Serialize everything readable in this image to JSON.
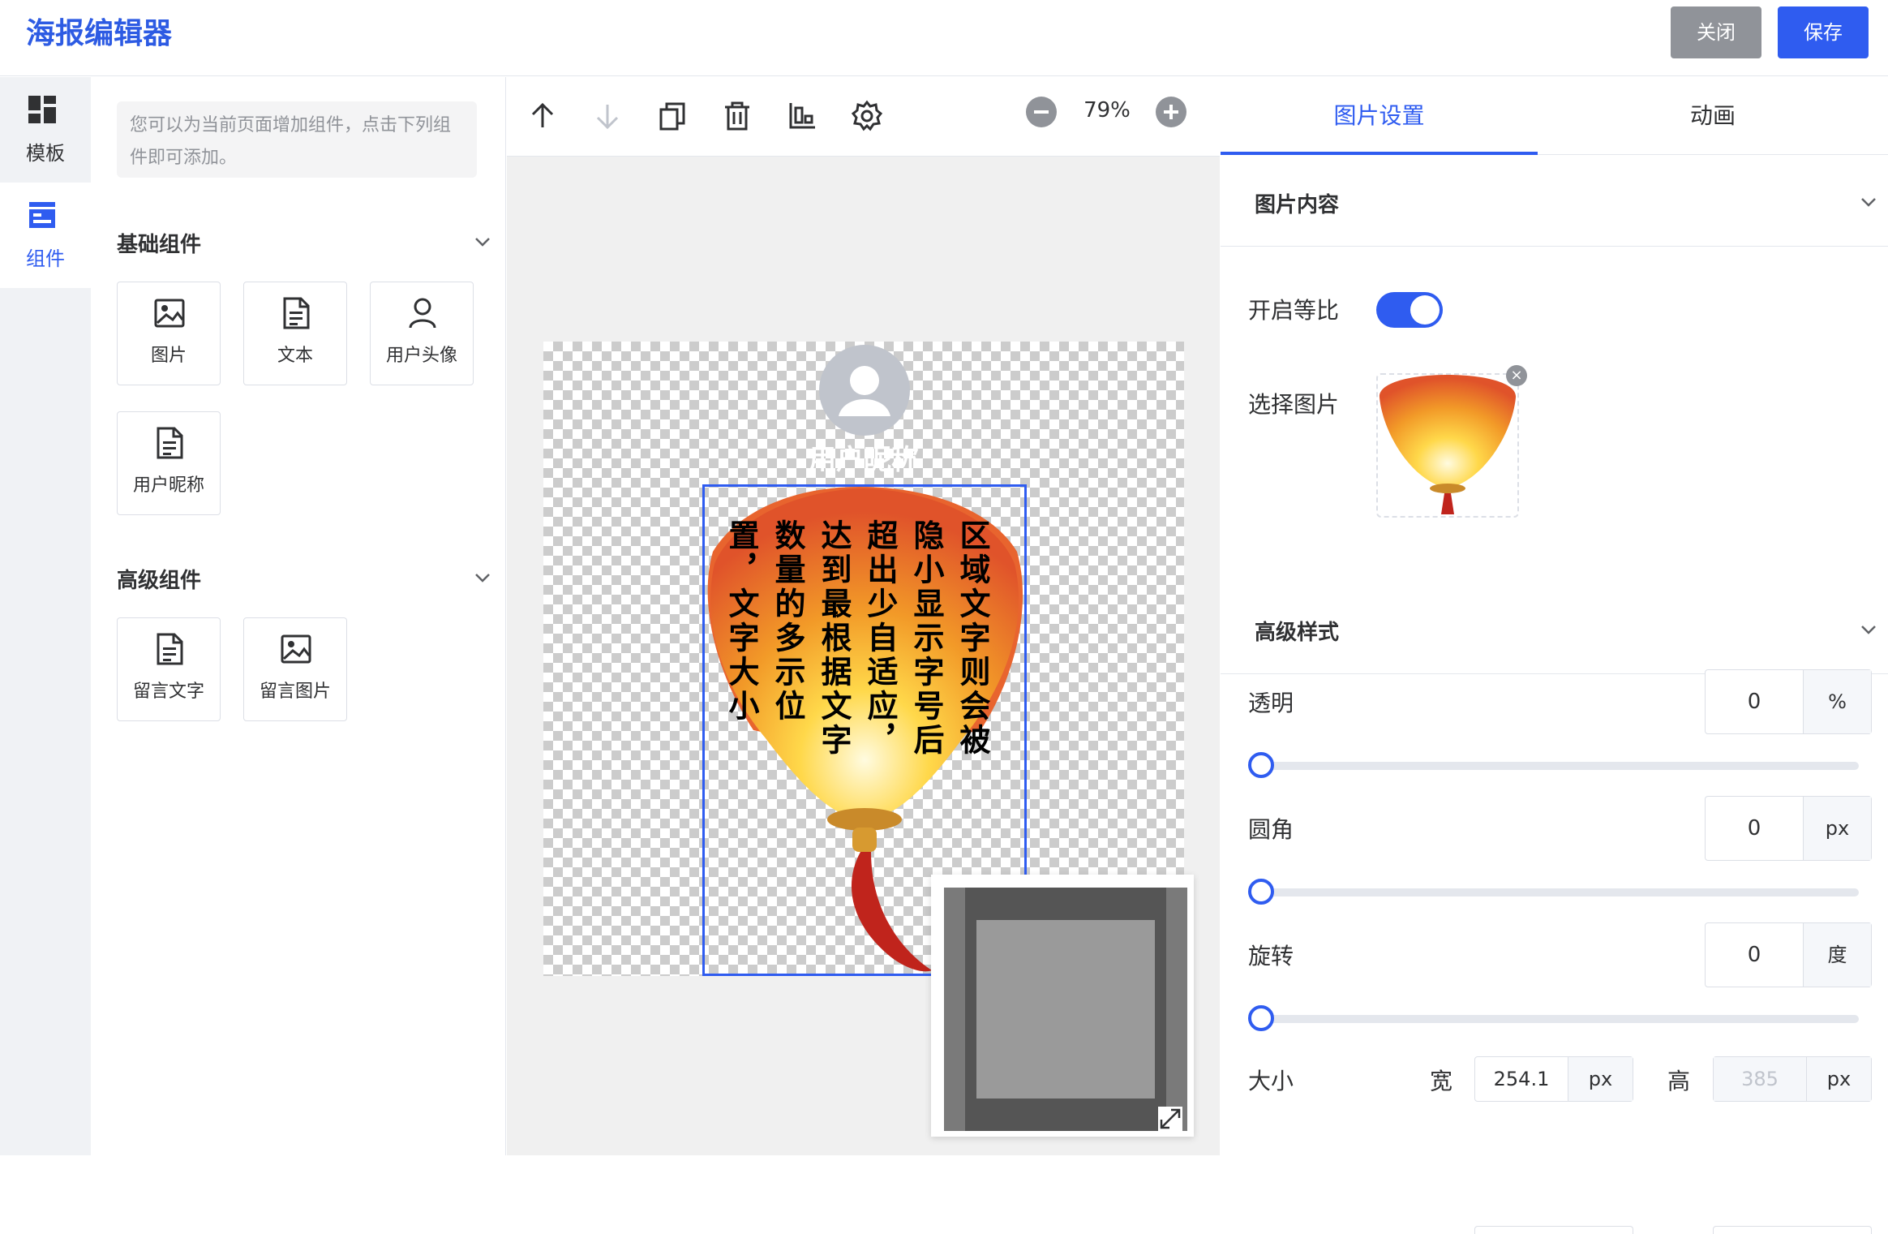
{
  "app": {
    "title": "海报编辑器",
    "close_label": "关闭",
    "save_label": "保存"
  },
  "leftnav": {
    "items": [
      {
        "label": "模板",
        "icon": "template-icon"
      },
      {
        "label": "组件",
        "icon": "component-icon"
      }
    ]
  },
  "panel": {
    "tip": "您可以为当前页面增加组件，点击下列组件即可添加。",
    "basic_title": "基础组件",
    "basic_items": [
      {
        "label": "图片",
        "icon": "image-icon"
      },
      {
        "label": "文本",
        "icon": "document-icon"
      },
      {
        "label": "用户头像",
        "icon": "user-icon"
      },
      {
        "label": "用户昵称",
        "icon": "document-icon"
      }
    ],
    "advanced_title": "高级组件",
    "advanced_items": [
      {
        "label": "留言文字",
        "icon": "document-icon"
      },
      {
        "label": "留言图片",
        "icon": "image-icon"
      }
    ]
  },
  "toolbar": {
    "zoom": "79%"
  },
  "poster": {
    "nickname": "用户昵称",
    "lantern_text": "区域文字则会被隐小显示字号后超出少自适应，达到最根据文字数量的多示位置，文字大小"
  },
  "settings": {
    "tabs": [
      {
        "label": "图片设置"
      },
      {
        "label": "动画"
      }
    ],
    "content_section": "图片内容",
    "ratio_label": "开启等比",
    "choose_image_label": "选择图片",
    "advanced_section": "高级样式",
    "opacity": {
      "label": "透明",
      "value": "0",
      "unit": "%"
    },
    "radius": {
      "label": "圆角",
      "value": "0",
      "unit": "px"
    },
    "rotate": {
      "label": "旋转",
      "value": "0",
      "unit": "度"
    },
    "size": {
      "label": "大小",
      "width_label": "宽",
      "width": "254.1",
      "width_unit": "px",
      "height_label": "高",
      "height": "385",
      "height_unit": "px"
    }
  },
  "colors": {
    "accent": "#2f5cf0",
    "title": "#2d5be3",
    "close_btn": "#909399"
  }
}
